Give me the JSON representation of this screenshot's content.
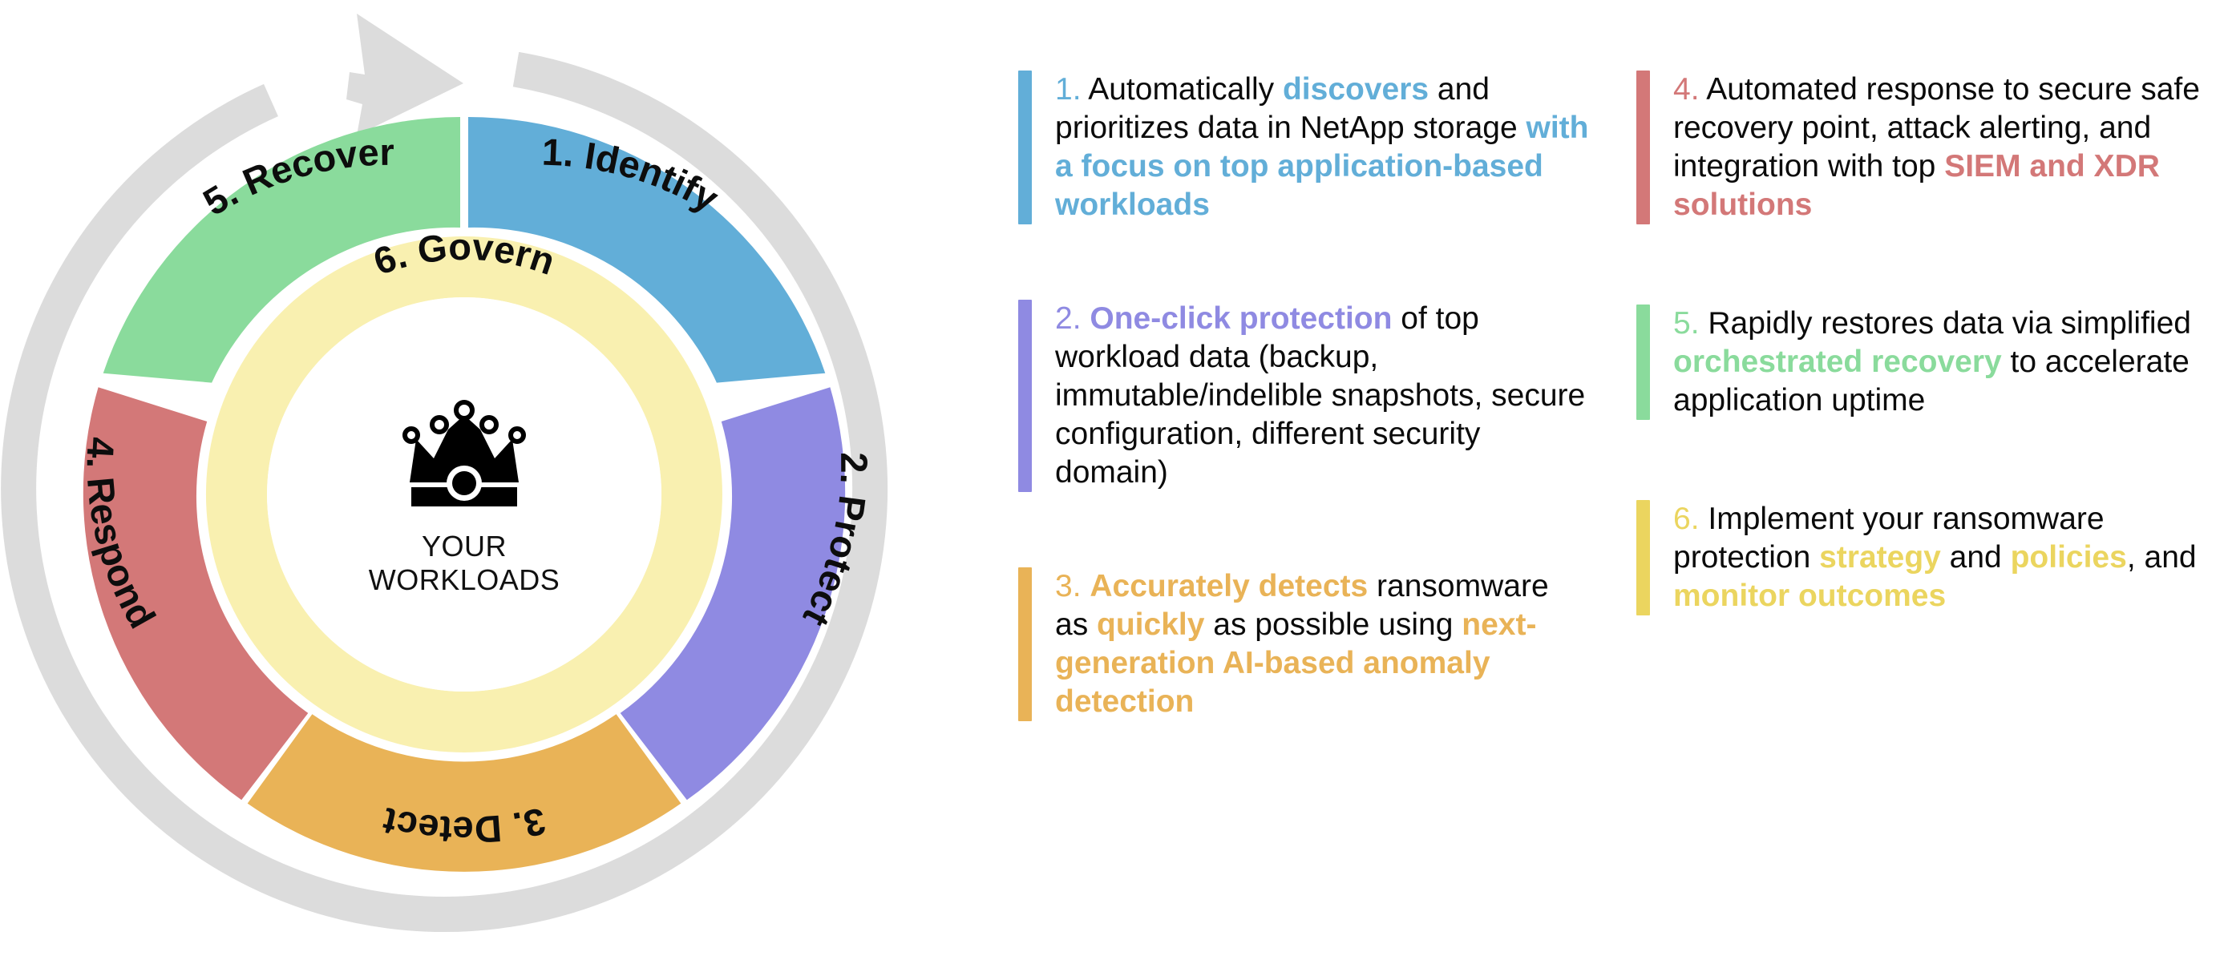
{
  "wheel": {
    "center_label_lines": [
      "YOUR",
      "WORKLOADS"
    ],
    "center_icon": "crown-icon",
    "inner_ring_label": "6. Govern",
    "inner_ring_color": "#f9f0b0",
    "outer_arrow_color": "#dcdcdc",
    "segments": [
      {
        "id": "identify",
        "label": "1. Identify",
        "color": "#62aed8"
      },
      {
        "id": "protect",
        "label": "2. Protect",
        "color": "#8f8ae2"
      },
      {
        "id": "detect",
        "label": "3. Detect",
        "color": "#e9b357"
      },
      {
        "id": "respond",
        "label": "4. Respond",
        "color": "#d37878"
      },
      {
        "id": "recover",
        "label": "5. Recover",
        "color": "#8adb9c"
      }
    ]
  },
  "callouts": {
    "left": [
      {
        "id": "callout-1",
        "number": "1.",
        "accent": "#62aed8",
        "runs": [
          {
            "text": "1. ",
            "style": "num"
          },
          {
            "text": "Automatically ",
            "style": "plain"
          },
          {
            "text": "discovers",
            "style": "hl"
          },
          {
            "text": " and prioritizes data in NetApp storage ",
            "style": "plain"
          },
          {
            "text": "with a focus on top application-based workloads",
            "style": "hl"
          }
        ]
      },
      {
        "id": "callout-2",
        "number": "2.",
        "accent": "#8f8ae2",
        "runs": [
          {
            "text": "2. ",
            "style": "num"
          },
          {
            "text": "One-click protection",
            "style": "hl"
          },
          {
            "text": " of top workload data (backup, immutable/indelible snapshots, secure configuration, different security domain)",
            "style": "plain"
          }
        ]
      },
      {
        "id": "callout-3",
        "number": "3.",
        "accent": "#e9b357",
        "runs": [
          {
            "text": "3. ",
            "style": "num"
          },
          {
            "text": "Accurately detects",
            "style": "hl"
          },
          {
            "text": " ransomware as ",
            "style": "plain"
          },
          {
            "text": "quickly",
            "style": "hl"
          },
          {
            "text": " as possible using ",
            "style": "plain"
          },
          {
            "text": "next-generation AI-based anomaly detection",
            "style": "hl"
          }
        ]
      }
    ],
    "right": [
      {
        "id": "callout-4",
        "number": "4.",
        "accent": "#d37878",
        "runs": [
          {
            "text": "4. ",
            "style": "num"
          },
          {
            "text": "Automated response to secure safe recovery point, attack alerting, and integration with top ",
            "style": "plain"
          },
          {
            "text": "SIEM and XDR solutions",
            "style": "hl"
          }
        ]
      },
      {
        "id": "callout-5",
        "number": "5.",
        "accent": "#8adb9c",
        "runs": [
          {
            "text": "5. ",
            "style": "num"
          },
          {
            "text": "Rapidly restores data via simplified ",
            "style": "plain"
          },
          {
            "text": "orchestrated recovery",
            "style": "hl"
          },
          {
            "text": " to accelerate application uptime",
            "style": "plain"
          }
        ]
      },
      {
        "id": "callout-6",
        "number": "6.",
        "accent": "#ebd55f",
        "runs": [
          {
            "text": "6. ",
            "style": "num"
          },
          {
            "text": "Implement your ransomware protection ",
            "style": "plain"
          },
          {
            "text": "strategy",
            "style": "hl"
          },
          {
            "text": " and ",
            "style": "plain"
          },
          {
            "text": "policies",
            "style": "hl"
          },
          {
            "text": ", and ",
            "style": "plain"
          },
          {
            "text": "monitor outcomes",
            "style": "hl"
          }
        ]
      }
    ]
  },
  "chart_data": {
    "type": "pie",
    "title": "NetApp ransomware protection lifecycle wheel",
    "legend": "none",
    "categories": [
      "1. Identify",
      "2. Protect",
      "3. Detect",
      "4. Respond",
      "5. Recover"
    ],
    "values": [
      20,
      20,
      20,
      20,
      20
    ],
    "units": "percent",
    "colors": [
      "#62aed8",
      "#8f8ae2",
      "#e9b357",
      "#d37878",
      "#8adb9c"
    ],
    "start_angle_deg": 0,
    "direction": "clockwise",
    "inner_ring": {
      "label": "6. Govern",
      "color": "#f9f0b0",
      "span_deg": 360
    },
    "hub": {
      "icon": "crown-icon",
      "label": "YOUR WORKLOADS"
    },
    "outer_decoration": {
      "type": "circular-arrow",
      "color": "#dcdcdc",
      "direction": "clockwise"
    },
    "grid": false,
    "xlabel": "",
    "ylabel": ""
  }
}
